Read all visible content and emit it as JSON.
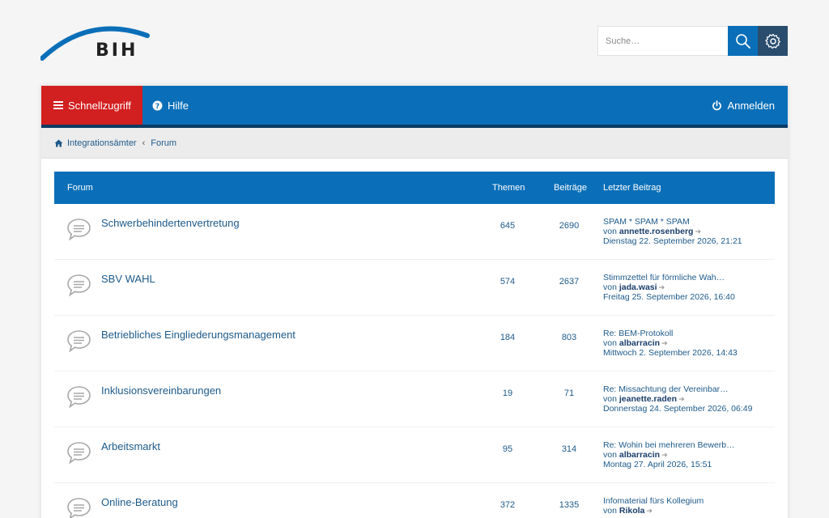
{
  "header": {
    "logo_text": "BIH",
    "search_placeholder": "Suche…"
  },
  "navbar": {
    "quick_label": "Schnellzugriff",
    "help_label": "Hilfe",
    "login_label": "Anmelden"
  },
  "breadcrumbs": {
    "home": "Integrationsämter",
    "forum": "Forum"
  },
  "table": {
    "col_forum": "Forum",
    "col_topics": "Themen",
    "col_posts": "Beiträge",
    "col_last": "Letzter Beitrag",
    "by_word": "von",
    "rows": [
      {
        "title": "Schwerbehindertenvertretung",
        "topics": "645",
        "posts": "2690",
        "last_title": "SPAM * SPAM * SPAM",
        "last_user": "annette.rosenberg",
        "last_date": "Dienstag 22. September 2026, 21:21"
      },
      {
        "title": "SBV WAHL",
        "topics": "574",
        "posts": "2637",
        "last_title": "Stimmzettel für förmliche Wah…",
        "last_user": "jada.wasi",
        "last_date": "Freitag 25. September 2026, 16:40"
      },
      {
        "title": "Betriebliches Eingliederungsmanagement",
        "topics": "184",
        "posts": "803",
        "last_title": "Re: BEM-Protokoll",
        "last_user": "albarracin",
        "last_date": "Mittwoch 2. September 2026, 14:43"
      },
      {
        "title": "Inklusionsvereinbarungen",
        "topics": "19",
        "posts": "71",
        "last_title": "Re: Missachtung der Vereinbar…",
        "last_user": "jeanette.raden",
        "last_date": "Donnerstag 24. September 2026, 06:49"
      },
      {
        "title": "Arbeitsmarkt",
        "topics": "95",
        "posts": "314",
        "last_title": "Re: Wohin bei mehreren Bewerb…",
        "last_user": "albarracin",
        "last_date": "Montag 27. April 2026, 15:51"
      },
      {
        "title": "Online-Beratung",
        "topics": "372",
        "posts": "1335",
        "last_title": "Infomaterial fürs Kollegium",
        "last_user": "Rikola",
        "last_date": ""
      }
    ]
  },
  "colors": {
    "primary_blue": "#0a6fb8",
    "quick_red": "#d21f1f",
    "dark_navy": "#2a4d6e"
  }
}
